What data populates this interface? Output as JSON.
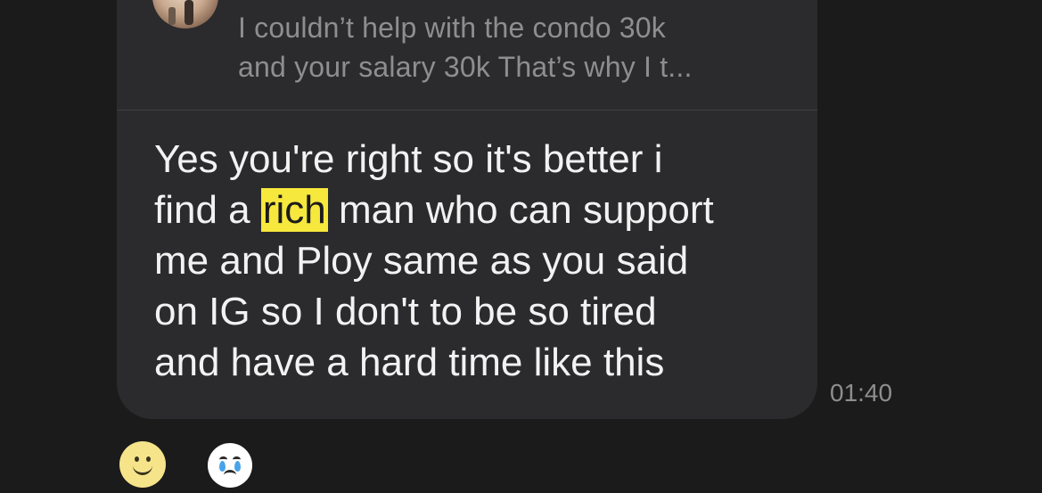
{
  "reply_preview": {
    "line1": "I couldn’t help with the condo 30k",
    "line2": "and your salary 30k That’s why I t..."
  },
  "message": {
    "line1": "Yes you're right so it's better i",
    "line2_before": "find a",
    "line2_highlight": "rich",
    "line2_after": "man who can support",
    "line3": "me and Ploy same as you said",
    "line4": "on IG so I don't to be so tired",
    "line5": "and have a hard time like this"
  },
  "timestamp": "01:40",
  "colors": {
    "background": "#1b1b1b",
    "bubble": "#2b2b2d",
    "highlight": "#f6e83c",
    "secondary_text": "#8e8e90"
  },
  "reactions": [
    {
      "icon": "smiling-face-icon"
    },
    {
      "icon": "crying-face-icon"
    }
  ]
}
